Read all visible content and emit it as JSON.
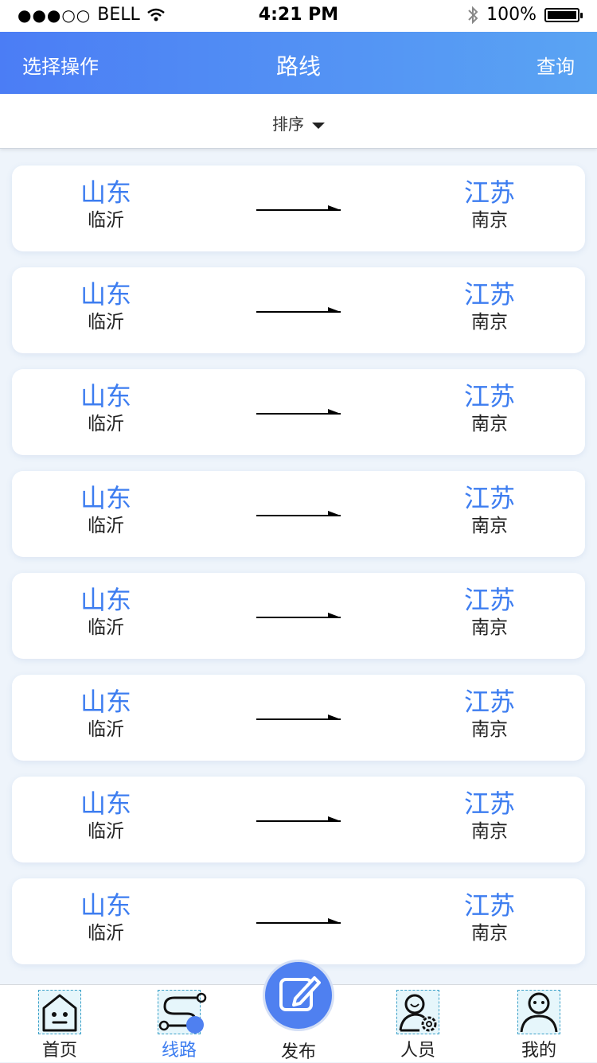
{
  "status_bar": {
    "signal": "●●●○○",
    "carrier": "BELL",
    "time": "4:21 PM",
    "battery_percent": "100%",
    "battery_level": 1.0
  },
  "navbar": {
    "left_label": "选择操作",
    "title": "路线",
    "right_label": "查询"
  },
  "sort": {
    "label": "排序"
  },
  "routes": [
    {
      "from_province": "山东",
      "from_city": "临沂",
      "to_province": "江苏",
      "to_city": "南京"
    },
    {
      "from_province": "山东",
      "from_city": "临沂",
      "to_province": "江苏",
      "to_city": "南京"
    },
    {
      "from_province": "山东",
      "from_city": "临沂",
      "to_province": "江苏",
      "to_city": "南京"
    },
    {
      "from_province": "山东",
      "from_city": "临沂",
      "to_province": "江苏",
      "to_city": "南京"
    },
    {
      "from_province": "山东",
      "from_city": "临沂",
      "to_province": "江苏",
      "to_city": "南京"
    },
    {
      "from_province": "山东",
      "from_city": "临沂",
      "to_province": "江苏",
      "to_city": "南京"
    },
    {
      "from_province": "山东",
      "from_city": "临沂",
      "to_province": "江苏",
      "to_city": "南京"
    },
    {
      "from_province": "山东",
      "from_city": "临沂",
      "to_province": "江苏",
      "to_city": "南京"
    }
  ],
  "tabbar": {
    "tabs": [
      {
        "label": "首页",
        "icon": "home-face-icon"
      },
      {
        "label": "线路",
        "icon": "route-icon"
      },
      {
        "label": "发布",
        "icon": "edit-icon"
      },
      {
        "label": "人员",
        "icon": "user-gear-icon"
      },
      {
        "label": "我的",
        "icon": "profile-icon"
      }
    ],
    "active_index": 1
  },
  "colors": {
    "accent": "#3d7df0",
    "nav_gradient_start": "#4b7df5",
    "nav_gradient_end": "#5aa4f3",
    "background": "#eef4fb"
  }
}
